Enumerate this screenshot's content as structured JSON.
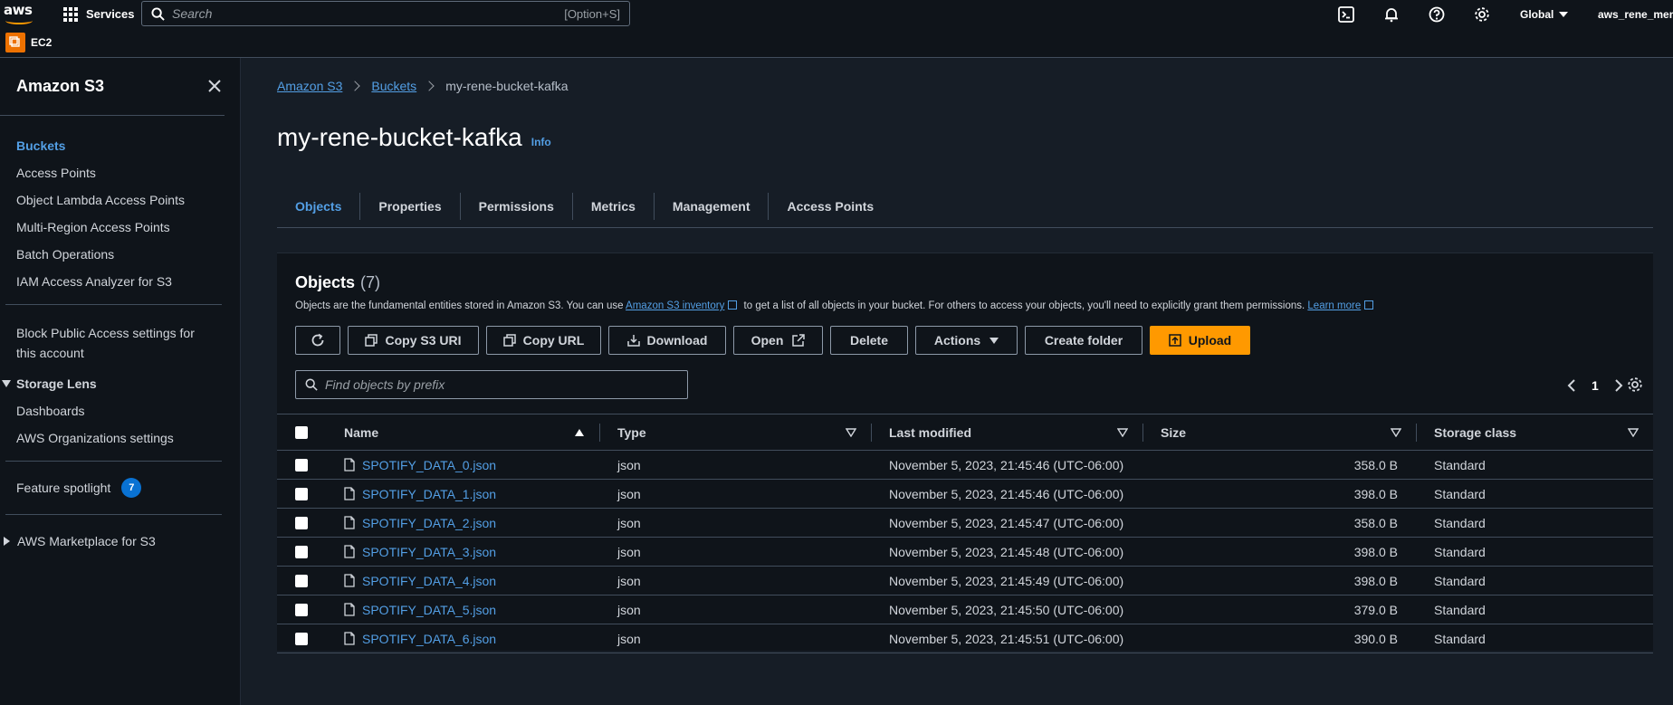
{
  "topnav": {
    "logo_text": "aws",
    "services_label": "Services",
    "search_placeholder": "Search",
    "search_shortcut": "[Option+S]",
    "region": "Global",
    "account": "aws_rene_mendoza"
  },
  "subnav": {
    "service_label": "EC2"
  },
  "sidebar": {
    "title": "Amazon S3",
    "primary_items": [
      {
        "label": "Buckets",
        "active": true
      },
      {
        "label": "Access Points"
      },
      {
        "label": "Object Lambda Access Points"
      },
      {
        "label": "Multi-Region Access Points"
      },
      {
        "label": "Batch Operations"
      },
      {
        "label": "IAM Access Analyzer for S3"
      }
    ],
    "block_public_access": "Block Public Access settings for this account",
    "storage_lens": {
      "label": "Storage Lens",
      "items": [
        "Dashboards",
        "AWS Organizations settings"
      ]
    },
    "feature_spotlight": {
      "label": "Feature spotlight",
      "count": "7"
    },
    "marketplace": "AWS Marketplace for S3"
  },
  "breadcrumb": {
    "items": [
      "Amazon S3",
      "Buckets"
    ],
    "current": "my-rene-bucket-kafka"
  },
  "page": {
    "title": "my-rene-bucket-kafka",
    "info": "Info"
  },
  "tabs": [
    "Objects",
    "Properties",
    "Permissions",
    "Metrics",
    "Management",
    "Access Points"
  ],
  "objects_panel": {
    "title": "Objects",
    "count": "(7)",
    "desc_1": "Objects are the fundamental entities stored in Amazon S3. You can use ",
    "desc_link": "Amazon S3 inventory",
    "desc_2": " to get a list of all objects in your bucket. For others to access your objects, you'll need to explicitly grant them permissions. ",
    "learn_more": "Learn more",
    "buttons": {
      "copy_uri": "Copy S3 URI",
      "copy_url": "Copy URL",
      "download": "Download",
      "open": "Open",
      "delete": "Delete",
      "actions": "Actions",
      "create_folder": "Create folder",
      "upload": "Upload"
    },
    "filter_placeholder": "Find objects by prefix",
    "page_number": "1",
    "columns": [
      "Name",
      "Type",
      "Last modified",
      "Size",
      "Storage class"
    ],
    "rows": [
      {
        "name": "SPOTIFY_DATA_0.json",
        "type": "json",
        "modified": "November 5, 2023, 21:45:46 (UTC-06:00)",
        "size": "358.0 B",
        "class": "Standard"
      },
      {
        "name": "SPOTIFY_DATA_1.json",
        "type": "json",
        "modified": "November 5, 2023, 21:45:46 (UTC-06:00)",
        "size": "398.0 B",
        "class": "Standard"
      },
      {
        "name": "SPOTIFY_DATA_2.json",
        "type": "json",
        "modified": "November 5, 2023, 21:45:47 (UTC-06:00)",
        "size": "358.0 B",
        "class": "Standard"
      },
      {
        "name": "SPOTIFY_DATA_3.json",
        "type": "json",
        "modified": "November 5, 2023, 21:45:48 (UTC-06:00)",
        "size": "398.0 B",
        "class": "Standard"
      },
      {
        "name": "SPOTIFY_DATA_4.json",
        "type": "json",
        "modified": "November 5, 2023, 21:45:49 (UTC-06:00)",
        "size": "398.0 B",
        "class": "Standard"
      },
      {
        "name": "SPOTIFY_DATA_5.json",
        "type": "json",
        "modified": "November 5, 2023, 21:45:50 (UTC-06:00)",
        "size": "379.0 B",
        "class": "Standard"
      },
      {
        "name": "SPOTIFY_DATA_6.json",
        "type": "json",
        "modified": "November 5, 2023, 21:45:51 (UTC-06:00)",
        "size": "390.0 B",
        "class": "Standard"
      }
    ]
  },
  "colors": {
    "accent_link": "#539fe5",
    "primary_button": "#ff9900",
    "ec2_badge": "#ed7100",
    "count_badge": "#0972d3"
  }
}
